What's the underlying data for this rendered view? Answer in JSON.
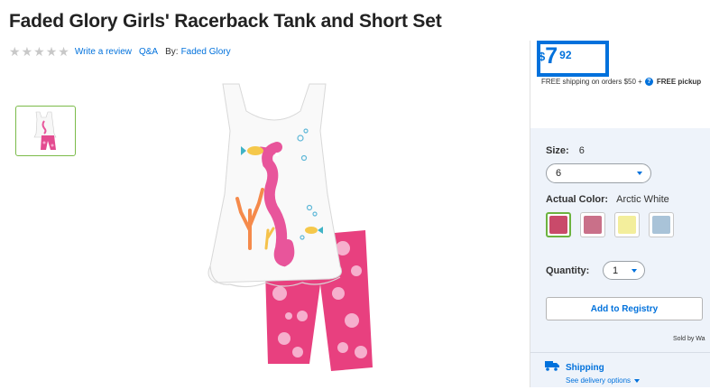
{
  "product": {
    "title": "Faded Glory Girls' Racerback Tank and Short Set",
    "rating_stars": 5,
    "write_review": "Write a review",
    "qa": "Q&A",
    "by_label": "By:",
    "brand": "Faded Glory"
  },
  "price": {
    "currency": "$",
    "dollars": "7",
    "cents": "92",
    "color": "#0071dc"
  },
  "shipping_note": {
    "text": "FREE shipping on orders $50 +",
    "help_icon": "?",
    "pickup": "FREE pickup"
  },
  "options": {
    "size_label": "Size:",
    "size_value": "6",
    "size_selected": "6",
    "color_label": "Actual Color:",
    "color_value": "Arctic White",
    "swatches": [
      "#c94a6a",
      "#c97089",
      "#f3ee9c",
      "#a9c3d8"
    ],
    "quantity_label": "Quantity:",
    "quantity_value": "1"
  },
  "actions": {
    "add_to_registry": "Add to Registry",
    "sold_by": "Sold by Wa"
  },
  "shipping": {
    "label": "Shipping",
    "delivery_link": "See delivery options"
  }
}
